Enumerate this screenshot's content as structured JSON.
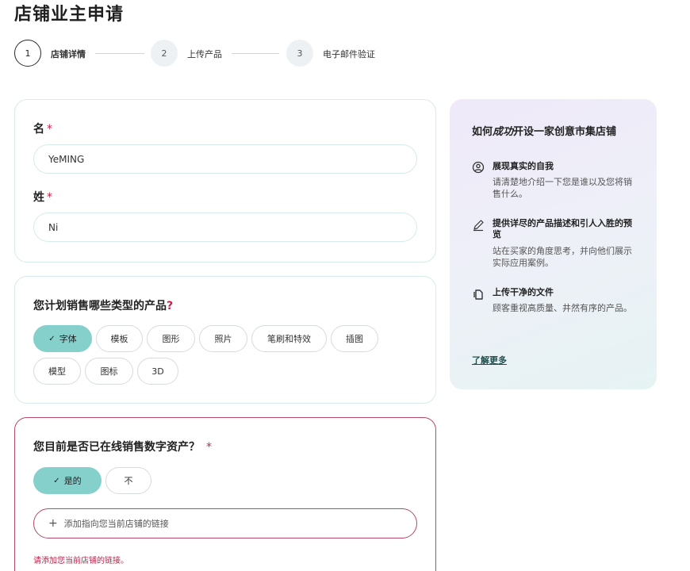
{
  "page": {
    "title": "店铺业主申请"
  },
  "stepper": {
    "steps": [
      {
        "number": "1",
        "label": "店铺详情",
        "state": "active"
      },
      {
        "number": "2",
        "label": "上传产品",
        "state": "inactive"
      },
      {
        "number": "3",
        "label": "电子邮件验证",
        "state": "inactive"
      }
    ]
  },
  "name_card": {
    "first_name": {
      "label": "名",
      "required_mark": "*",
      "value": "YeMING"
    },
    "last_name": {
      "label": "姓",
      "required_mark": "*",
      "value": "Ni"
    }
  },
  "product_types": {
    "title": "您计划销售哪些类型的产品",
    "title_mark": "?",
    "check_glyph": "✓",
    "chips": [
      {
        "label": "字体",
        "selected": true
      },
      {
        "label": "模板",
        "selected": false
      },
      {
        "label": "图形",
        "selected": false
      },
      {
        "label": "照片",
        "selected": false
      },
      {
        "label": "笔刷和特效",
        "selected": false
      },
      {
        "label": "插图",
        "selected": false
      },
      {
        "label": "模型",
        "selected": false
      },
      {
        "label": "图标",
        "selected": false
      },
      {
        "label": "3D",
        "selected": false
      }
    ]
  },
  "selling_online": {
    "title": "您目前是否已在线销售数字资产？",
    "required_mark": "*",
    "options": [
      {
        "label": "是的",
        "selected": true
      },
      {
        "label": "不",
        "selected": false
      }
    ],
    "link_input": {
      "plus": "+",
      "placeholder": "添加指向您当前店铺的链接"
    },
    "error": "请添加您当前店铺的链接。"
  },
  "side_panel": {
    "title_prefix": "如何",
    "title_emphasis": "成功",
    "title_suffix": "开设一家创意市集店铺",
    "tips": [
      {
        "icon": "user-circle-icon",
        "heading": "展现真实的自我",
        "body": "请清楚地介绍一下您是谁以及您将销售什么。"
      },
      {
        "icon": "pencil-icon",
        "heading": "提供详尽的产品描述和引人入胜的预览",
        "body": "站在买家的角度思考，并向他们展示实际应用案例。"
      },
      {
        "icon": "file-copy-icon",
        "heading": "上传干净的文件",
        "body": "顾客重视高质量、井然有序的产品。"
      }
    ],
    "learn_more": "了解更多"
  },
  "colors": {
    "accent_teal": "#86d0cc",
    "error_red": "#b54a68",
    "card_border": "#d7ebe9"
  }
}
